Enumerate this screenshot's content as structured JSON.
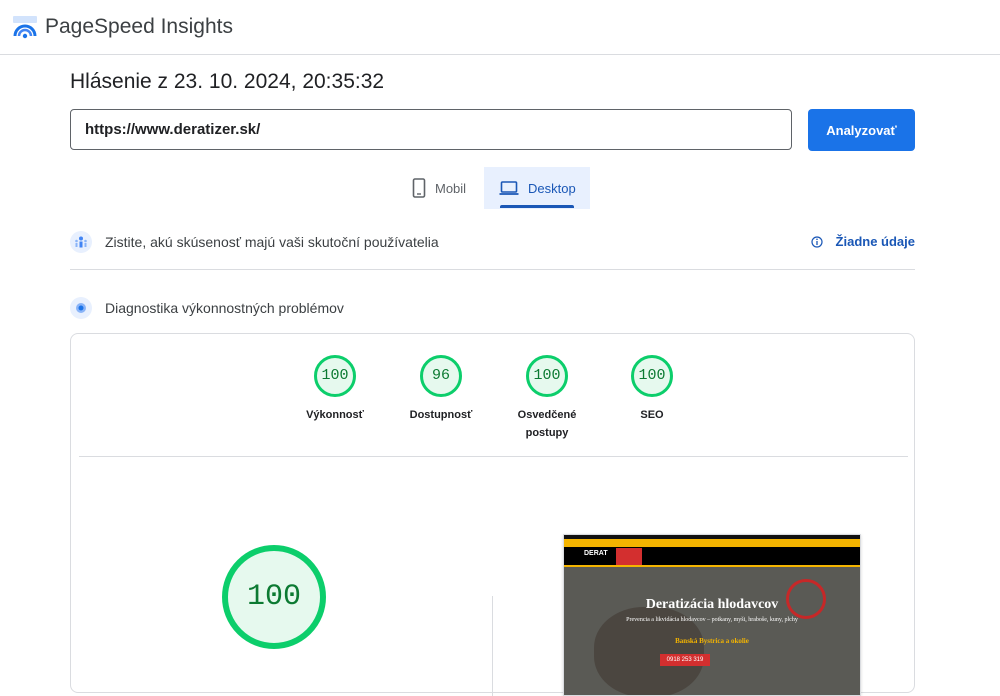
{
  "header": {
    "app_title": "PageSpeed Insights",
    "logo_icon": "pagespeed-logo-icon"
  },
  "report": {
    "title": "Hlásenie z 23. 10. 2024, 20:35:32"
  },
  "search": {
    "url_value": "https://www.deratizer.sk/",
    "analyze_label": "Analyzovať"
  },
  "tabs": [
    {
      "label": "Mobil",
      "icon": "smartphone-icon",
      "selected": false
    },
    {
      "label": "Desktop",
      "icon": "laptop-icon",
      "selected": true
    }
  ],
  "field_data": {
    "text": "Zistite, akú skúsenosť majú vaši skutoční používatelia",
    "status": "Žiadne údaje",
    "icon": "users-icon"
  },
  "diagnostics": {
    "text": "Diagnostika výkonnostných problémov",
    "icon": "lab-icon"
  },
  "scores": [
    {
      "label": "Výkonnosť",
      "value": "100"
    },
    {
      "label": "Dostupnosť",
      "value": "96"
    },
    {
      "label": "Osvedčené postupy",
      "value": "100"
    },
    {
      "label": "SEO",
      "value": "100"
    }
  ],
  "big_score": "100",
  "thumbnail": {
    "logo": "DERAT",
    "heading": "Deratizácia hlodavcov",
    "subtext": "Prevencia a likvidácia hlodavcov – potkany, myši, hraboše, kuny, plchy",
    "city": "Banská Bystrica a okolie",
    "phone": "0918 253 319"
  },
  "colors": {
    "accent": "#1a73e8",
    "pass_green": "#0cce6b",
    "pass_text": "#0c7a32",
    "tab_selected_bg": "#e8f0fe"
  }
}
